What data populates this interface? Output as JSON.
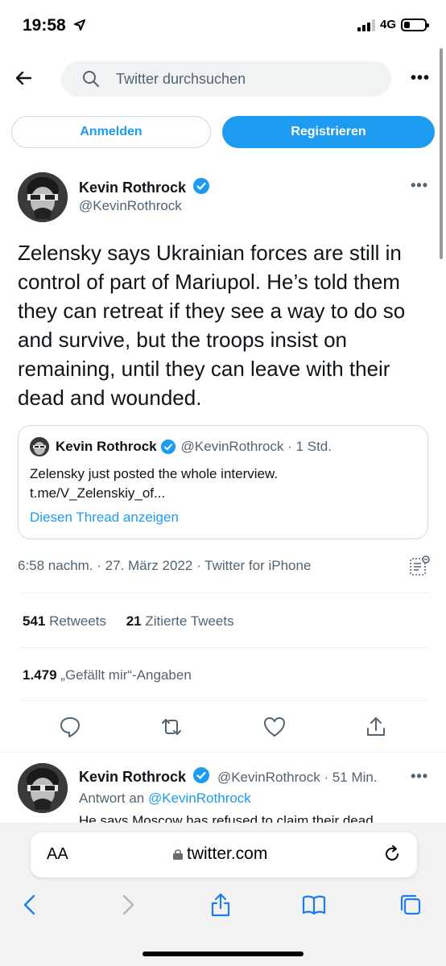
{
  "status": {
    "time": "19:58",
    "network": "4G"
  },
  "search": {
    "placeholder": "Twitter durchsuchen"
  },
  "auth": {
    "login_label": "Anmelden",
    "register_label": "Registrieren"
  },
  "tweet": {
    "author_name": "Kevin Rothrock",
    "author_handle": "@KevinRothrock",
    "text": "Zelensky says Ukrainian forces are still in control of part of Mariupol. He’s told them they can retreat if they see a way to do so and survive, but the troops insist on remaining, until they can leave with their dead and wounded.",
    "quote": {
      "author_name": "Kevin Rothrock",
      "meta": "@KevinRothrock · 1 Std.",
      "text": "Zelensky just posted the whole interview. t.me/V_Zelenskiy_of...",
      "show_thread": "Diesen Thread anzeigen"
    },
    "meta": "6:58 nachm. · 27. März 2022 · Twitter for iPhone",
    "retweets_count": "541",
    "retweets_label": "Retweets",
    "quotes_count": "21",
    "quotes_label": "Zitierte Tweets",
    "likes_count": "1.479",
    "likes_label": "„Gefällt mir“-Angaben"
  },
  "reply": {
    "author_name": "Kevin Rothrock",
    "meta": "@KevinRothrock · 51 Min.",
    "reply_prefix": "Antwort an",
    "reply_to": "@KevinRothrock",
    "text": "He says Moscow has refused to claim their dead"
  },
  "browser": {
    "aa": "AA",
    "url": "twitter.com"
  },
  "colors": {
    "accent": "#1d9bf0",
    "text": "#0f1419",
    "muted": "#536471"
  }
}
